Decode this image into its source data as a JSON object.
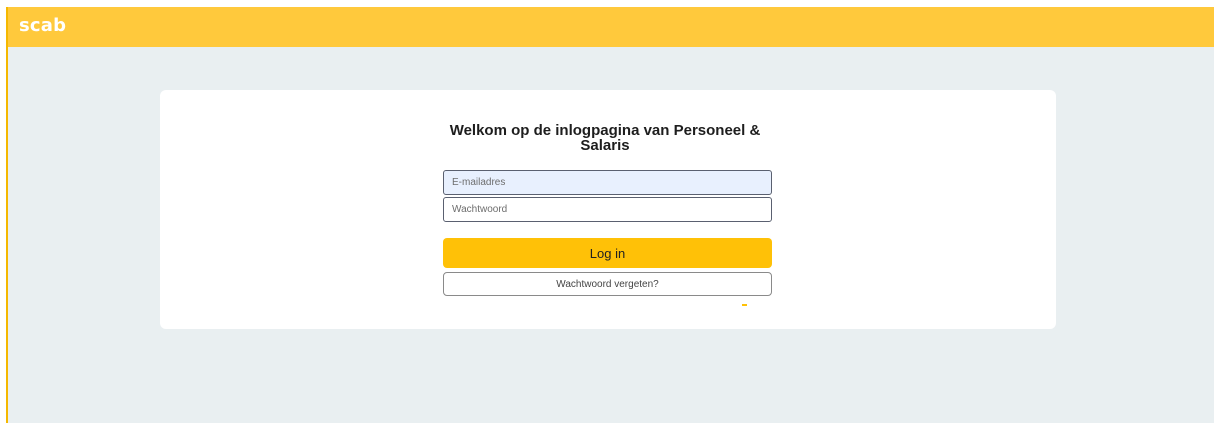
{
  "header": {
    "brand": "scab",
    "brand_color": "#ffc93c"
  },
  "login": {
    "title": "Welkom op de inlogpagina van Personeel & Salaris",
    "email_placeholder": "E-mailadres",
    "password_placeholder": "Wachtwoord",
    "login_label": "Log in",
    "forgot_label": "Wachtwoord vergeten?",
    "accent_color": "#ffc107"
  }
}
